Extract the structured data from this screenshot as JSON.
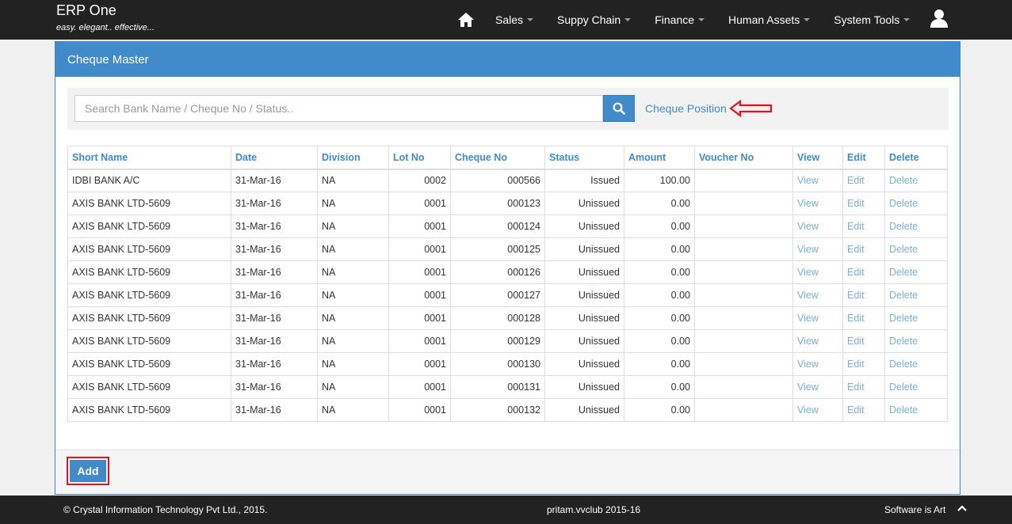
{
  "brand": {
    "title": "ERP One",
    "tagline": "easy. elegant.. effective..."
  },
  "nav": {
    "home_icon": "home-icon",
    "items": [
      {
        "label": "Sales"
      },
      {
        "label": "Suppy Chain"
      },
      {
        "label": "Finance"
      },
      {
        "label": "Human Assets"
      },
      {
        "label": "System Tools"
      }
    ],
    "user_icon": "user-icon"
  },
  "panel": {
    "title": "Cheque Master",
    "search": {
      "placeholder": "Search Bank Name / Cheque No / Status..",
      "value": ""
    },
    "cheque_position_label": "Cheque Position",
    "add_label": "Add"
  },
  "table": {
    "headers": [
      "Short Name",
      "Date",
      "Division",
      "Lot No",
      "Cheque No",
      "Status",
      "Amount",
      "Voucher No",
      "View",
      "Edit",
      "Delete"
    ],
    "rows": [
      {
        "short_name": "IDBI BANK A/C",
        "date": "31-Mar-16",
        "division": "NA",
        "lot_no": "0002",
        "cheque_no": "000566",
        "status": "Issued",
        "amount": "100.00",
        "voucher_no": "",
        "view": "View",
        "edit": "Edit",
        "delete": "Delete"
      },
      {
        "short_name": "AXIS BANK LTD-5609",
        "date": "31-Mar-16",
        "division": "NA",
        "lot_no": "0001",
        "cheque_no": "000123",
        "status": "Unissued",
        "amount": "0.00",
        "voucher_no": "",
        "view": "View",
        "edit": "Edit",
        "delete": "Delete"
      },
      {
        "short_name": "AXIS BANK LTD-5609",
        "date": "31-Mar-16",
        "division": "NA",
        "lot_no": "0001",
        "cheque_no": "000124",
        "status": "Unissued",
        "amount": "0.00",
        "voucher_no": "",
        "view": "View",
        "edit": "Edit",
        "delete": "Delete"
      },
      {
        "short_name": "AXIS BANK LTD-5609",
        "date": "31-Mar-16",
        "division": "NA",
        "lot_no": "0001",
        "cheque_no": "000125",
        "status": "Unissued",
        "amount": "0.00",
        "voucher_no": "",
        "view": "View",
        "edit": "Edit",
        "delete": "Delete"
      },
      {
        "short_name": "AXIS BANK LTD-5609",
        "date": "31-Mar-16",
        "division": "NA",
        "lot_no": "0001",
        "cheque_no": "000126",
        "status": "Unissued",
        "amount": "0.00",
        "voucher_no": "",
        "view": "View",
        "edit": "Edit",
        "delete": "Delete"
      },
      {
        "short_name": "AXIS BANK LTD-5609",
        "date": "31-Mar-16",
        "division": "NA",
        "lot_no": "0001",
        "cheque_no": "000127",
        "status": "Unissued",
        "amount": "0.00",
        "voucher_no": "",
        "view": "View",
        "edit": "Edit",
        "delete": "Delete"
      },
      {
        "short_name": "AXIS BANK LTD-5609",
        "date": "31-Mar-16",
        "division": "NA",
        "lot_no": "0001",
        "cheque_no": "000128",
        "status": "Unissued",
        "amount": "0.00",
        "voucher_no": "",
        "view": "View",
        "edit": "Edit",
        "delete": "Delete"
      },
      {
        "short_name": "AXIS BANK LTD-5609",
        "date": "31-Mar-16",
        "division": "NA",
        "lot_no": "0001",
        "cheque_no": "000129",
        "status": "Unissued",
        "amount": "0.00",
        "voucher_no": "",
        "view": "View",
        "edit": "Edit",
        "delete": "Delete"
      },
      {
        "short_name": "AXIS BANK LTD-5609",
        "date": "31-Mar-16",
        "division": "NA",
        "lot_no": "0001",
        "cheque_no": "000130",
        "status": "Unissued",
        "amount": "0.00",
        "voucher_no": "",
        "view": "View",
        "edit": "Edit",
        "delete": "Delete"
      },
      {
        "short_name": "AXIS BANK LTD-5609",
        "date": "31-Mar-16",
        "division": "NA",
        "lot_no": "0001",
        "cheque_no": "000131",
        "status": "Unissued",
        "amount": "0.00",
        "voucher_no": "",
        "view": "View",
        "edit": "Edit",
        "delete": "Delete"
      },
      {
        "short_name": "AXIS BANK LTD-5609",
        "date": "31-Mar-16",
        "division": "NA",
        "lot_no": "0001",
        "cheque_no": "000132",
        "status": "Unissued",
        "amount": "0.00",
        "voucher_no": "",
        "view": "View",
        "edit": "Edit",
        "delete": "Delete"
      }
    ]
  },
  "footer": {
    "copyright": "© Crystal Information Technology Pvt Ltd., 2015.",
    "session": "pritam.vvclub 2015-16",
    "slogan": "Software is Art",
    "scroll_top_icon": "chevron-up-icon"
  },
  "colors": {
    "navbar": "#222222",
    "primary": "#428bca",
    "highlight": "#e0141e"
  }
}
